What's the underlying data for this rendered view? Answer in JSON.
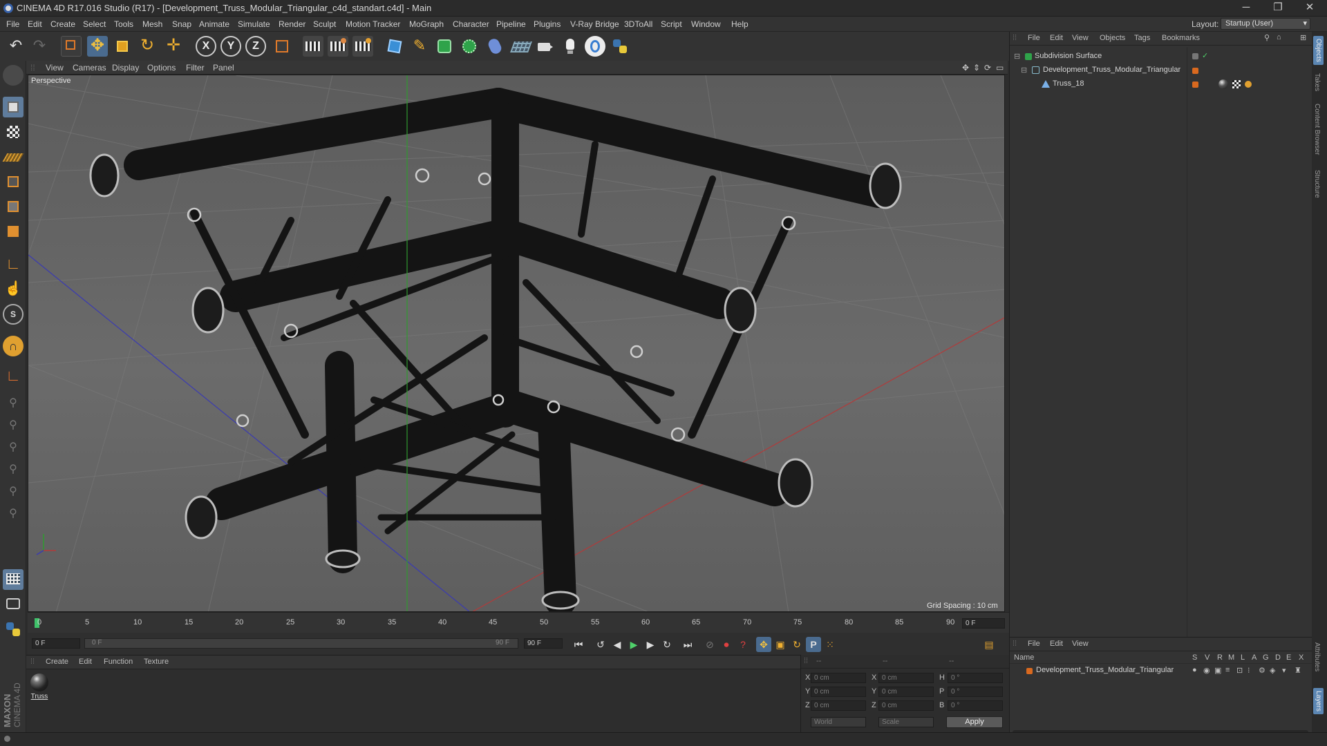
{
  "window": {
    "title": "CINEMA 4D R17.016 Studio (R17) - [Development_Truss_Modular_Triangular_c4d_standart.c4d] - Main",
    "minimize": "─",
    "maximize": "❐",
    "close": "✕"
  },
  "menu": [
    "File",
    "Edit",
    "Create",
    "Select",
    "Tools",
    "Mesh",
    "Snap",
    "Animate",
    "Simulate",
    "Render",
    "Sculpt",
    "Motion Tracker",
    "MoGraph",
    "Character",
    "Pipeline",
    "Plugins",
    "V-Ray Bridge",
    "3DToAll",
    "Script",
    "Window",
    "Help"
  ],
  "layout": {
    "label": "Layout:",
    "value": "Startup (User)"
  },
  "viewport": {
    "menu": [
      "View",
      "Cameras",
      "Display",
      "Options",
      "Filter",
      "Panel"
    ],
    "label": "Perspective",
    "grid_spacing": "Grid Spacing : 10 cm"
  },
  "timeline": {
    "ticks": [
      "0",
      "5",
      "10",
      "15",
      "20",
      "25",
      "30",
      "35",
      "40",
      "45",
      "50",
      "55",
      "60",
      "65",
      "70",
      "75",
      "80",
      "85",
      "90"
    ],
    "current_frame": "0 F",
    "start_field": "0 F",
    "range_start": "0 F",
    "range_end": "90 F",
    "end_field": "90 F"
  },
  "material_panel": {
    "menu": [
      "Create",
      "Edit",
      "Function",
      "Texture"
    ],
    "material_name": "Truss"
  },
  "coordinates": {
    "header": [
      "--",
      "--",
      "--"
    ],
    "rows": [
      {
        "a": "X",
        "av": "0 cm",
        "b": "X",
        "bv": "0 cm",
        "c": "H",
        "cv": "0 °"
      },
      {
        "a": "Y",
        "av": "0 cm",
        "b": "Y",
        "bv": "0 cm",
        "c": "P",
        "cv": "0 °"
      },
      {
        "a": "Z",
        "av": "0 cm",
        "b": "Z",
        "bv": "0 cm",
        "c": "B",
        "cv": "0 °"
      }
    ],
    "world": "World",
    "scale": "Scale",
    "apply": "Apply"
  },
  "object_manager": {
    "menu": [
      "File",
      "Edit",
      "View",
      "Objects",
      "Tags",
      "Bookmarks"
    ],
    "objects": [
      {
        "name": "Subdivision Surface",
        "indent": 0
      },
      {
        "name": "Development_Truss_Modular_Triangular",
        "indent": 1
      },
      {
        "name": "Truss_18",
        "indent": 2
      }
    ]
  },
  "layer_manager": {
    "menu": [
      "File",
      "Edit",
      "View"
    ],
    "columns": [
      "Name",
      "S",
      "V",
      "R",
      "M",
      "L",
      "A",
      "G",
      "D",
      "E",
      "X"
    ],
    "layers": [
      {
        "name": "Development_Truss_Modular_Triangular"
      }
    ]
  },
  "side_tabs": [
    "Objects",
    "Takes",
    "Content Browser",
    "Structure",
    "Attributes",
    "Layers"
  ],
  "brand": {
    "line1": "MAXON",
    "line2": "CINEMA 4D"
  },
  "colors": {
    "accent": "#e8a33a",
    "layer_orange": "#d9691f",
    "axis_x": "#b23a3a",
    "axis_y": "#2f9a2f",
    "axis_z": "#3a3ab2",
    "selected_tab": "#5b86b3"
  }
}
